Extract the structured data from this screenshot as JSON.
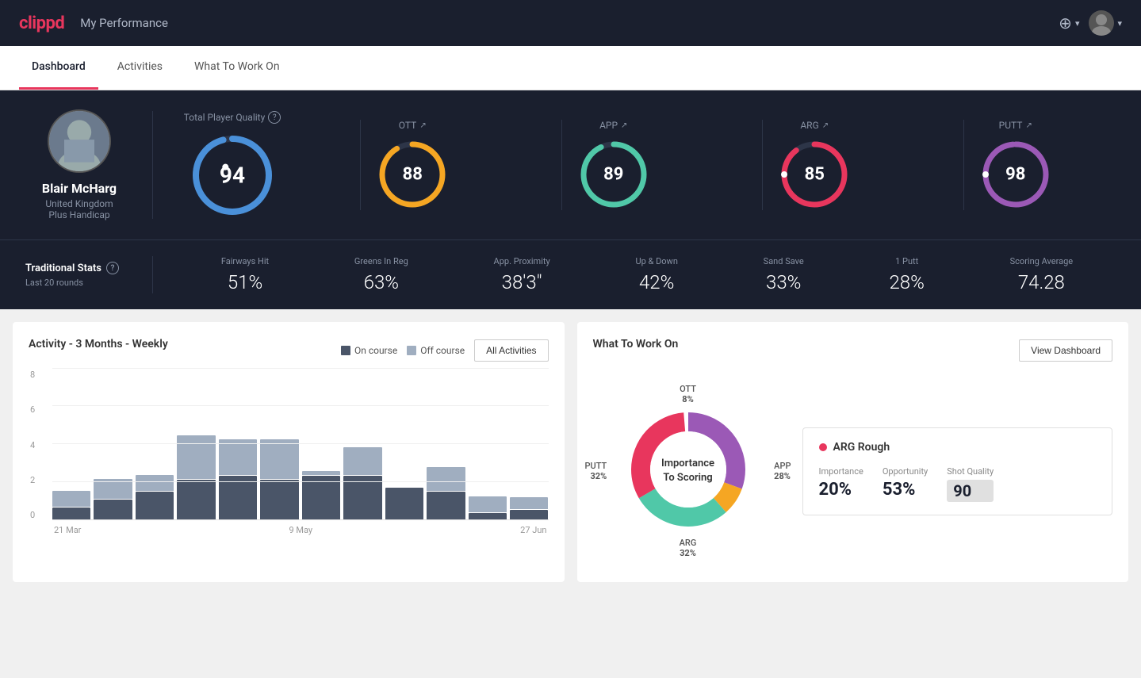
{
  "header": {
    "logo": "clippd",
    "title": "My Performance",
    "add_icon": "⊕",
    "user_icon": "▾"
  },
  "tabs": [
    {
      "label": "Dashboard",
      "active": true
    },
    {
      "label": "Activities",
      "active": false
    },
    {
      "label": "What To Work On",
      "active": false
    }
  ],
  "player": {
    "name": "Blair McHarg",
    "country": "United Kingdom",
    "handicap": "Plus Handicap"
  },
  "total_quality": {
    "label": "Total Player Quality",
    "value": "94",
    "color": "#4a90d9"
  },
  "sub_scores": [
    {
      "label": "OTT",
      "value": "88",
      "color": "#f5a623",
      "trend": "↗"
    },
    {
      "label": "APP",
      "value": "89",
      "color": "#50c8a8",
      "trend": "↗"
    },
    {
      "label": "ARG",
      "value": "85",
      "color": "#e8365d",
      "trend": "↗"
    },
    {
      "label": "PUTT",
      "value": "98",
      "color": "#9b59b6",
      "trend": "↗"
    }
  ],
  "trad_stats": {
    "title": "Traditional Stats",
    "subtitle": "Last 20 rounds",
    "items": [
      {
        "label": "Fairways Hit",
        "value": "51%"
      },
      {
        "label": "Greens In Reg",
        "value": "63%"
      },
      {
        "label": "App. Proximity",
        "value": "38'3\""
      },
      {
        "label": "Up & Down",
        "value": "42%"
      },
      {
        "label": "Sand Save",
        "value": "33%"
      },
      {
        "label": "1 Putt",
        "value": "28%"
      },
      {
        "label": "Scoring Average",
        "value": "74.28"
      }
    ]
  },
  "activity_chart": {
    "title": "Activity - 3 Months - Weekly",
    "legend": {
      "on_course": "On course",
      "off_course": "Off course"
    },
    "all_activities_btn": "All Activities",
    "x_labels": [
      "21 Mar",
      "9 May",
      "27 Jun"
    ],
    "y_labels": [
      "8",
      "6",
      "4",
      "2",
      "0"
    ],
    "bars": [
      {
        "dark": 15,
        "light": 20
      },
      {
        "dark": 20,
        "light": 15
      },
      {
        "dark": 25,
        "light": 15
      },
      {
        "dark": 30,
        "light": 55
      },
      {
        "dark": 35,
        "light": 50
      },
      {
        "dark": 40,
        "light": 30
      },
      {
        "dark": 35,
        "light": 5
      },
      {
        "dark": 45,
        "light": 35
      },
      {
        "dark": 40,
        "light": 0
      },
      {
        "dark": 30,
        "light": 25
      },
      {
        "dark": 5,
        "light": 25
      },
      {
        "dark": 10,
        "light": 10
      }
    ]
  },
  "what_to_work": {
    "title": "What To Work On",
    "view_dashboard_btn": "View Dashboard",
    "donut_center": "Importance\nTo Scoring",
    "segments": [
      {
        "label": "OTT",
        "percent": "8%",
        "color": "#f5a623",
        "position": "top"
      },
      {
        "label": "APP",
        "percent": "28%",
        "color": "#50c8a8",
        "position": "right"
      },
      {
        "label": "ARG",
        "percent": "32%",
        "color": "#e8365d",
        "position": "bottom"
      },
      {
        "label": "PUTT",
        "percent": "32%",
        "color": "#9b59b6",
        "position": "left"
      }
    ],
    "arg_rough": {
      "title": "ARG Rough",
      "importance_label": "Importance",
      "importance_value": "20%",
      "opportunity_label": "Opportunity",
      "opportunity_value": "53%",
      "shot_quality_label": "Shot Quality",
      "shot_quality_value": "90"
    }
  }
}
